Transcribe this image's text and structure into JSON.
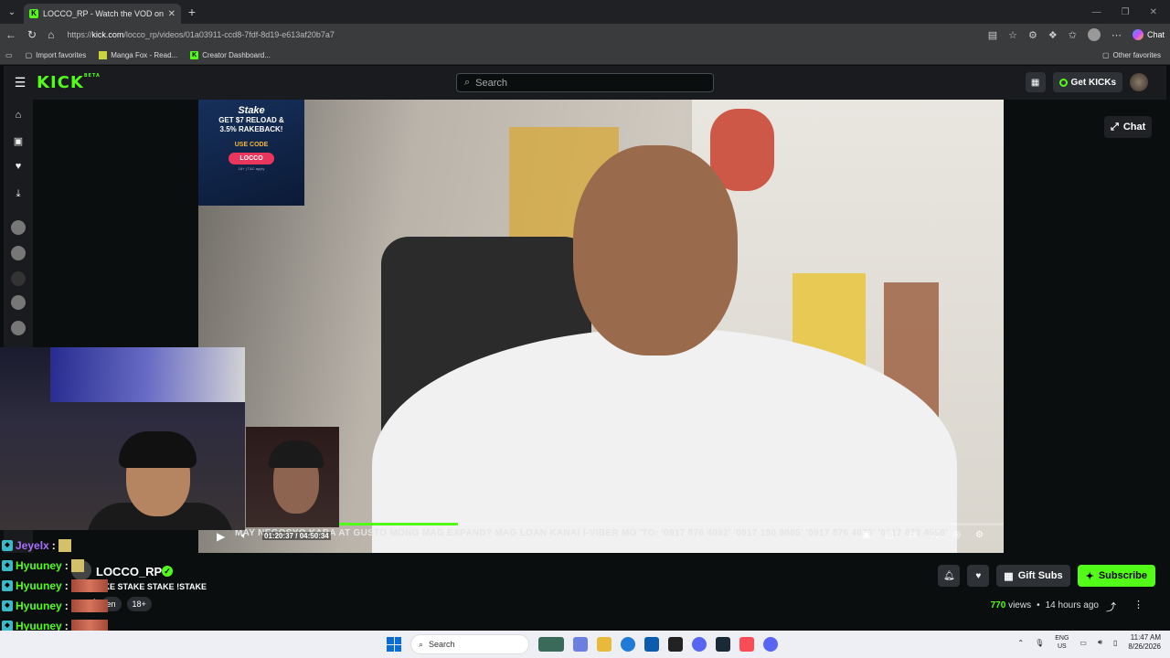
{
  "browser": {
    "tab_title": "LOCCO_RP - Watch the VOD on Kick",
    "url_prefix": "https://",
    "url_host": "kick.com",
    "url_path": "/locco_rp/videos/01a03911-ccd8-7fdf-8d19-e613af20b7a7",
    "chat_label": "Chat",
    "favorites": [
      {
        "label": "Import favorites"
      },
      {
        "label": "Manga Fox - Read..."
      },
      {
        "label": "Creator Dashboard..."
      }
    ],
    "other_favorites": "Other favorites"
  },
  "kick_header": {
    "logo": "KICK",
    "logo_badge": "BETA",
    "search_placeholder": "Search",
    "get_kicks": "Get KICKs"
  },
  "player": {
    "chat_button": "Chat",
    "ad": {
      "brand": "Stake",
      "line1": "GET $7 RELOAD &",
      "line2": "3.5% RAKEBACK!",
      "use_code": "USE CODE",
      "code": "LOCCO",
      "fine_print": "18+ | T&C apply"
    },
    "ticker": "MAY NEGOSYO KABA AT GUSTO MONG MAG EXPAND? MAG LOAN KANA! I-VIBER MO 'TO: '0917 876 4092' '0917 180 9885' '0917 876 4076' '0917 873 4958'",
    "elapsed": "01:20:37",
    "separator": "/",
    "duration": "04:50:34",
    "progress": 0.28
  },
  "stream_chat": [
    {
      "user": "Jeyelx",
      "sep": ":",
      "color": "purple"
    },
    {
      "user": "Hyuuney",
      "sep": ":",
      "color": "green"
    },
    {
      "user": "Hyuuney",
      "sep": ":",
      "color": "green"
    },
    {
      "user": "Hyuuney",
      "sep": ":",
      "color": "green"
    },
    {
      "user": "Hyuuney",
      "sep": ":",
      "color": "green"
    },
    {
      "user": "Hyuuney",
      "sep": ":",
      "color": "green"
    }
  ],
  "channel": {
    "name": "LOCCO_RP",
    "title": "AKE STAKE STAKE !STAKE",
    "tags": [
      "t",
      "en",
      "18+"
    ],
    "gift_subs": "Gift Subs",
    "subscribe": "Subscribe",
    "views": "770",
    "views_label": "views",
    "bullet": "•",
    "posted": "14 hours ago"
  },
  "taskbar": {
    "search": "Search",
    "lang_top": "ENG",
    "lang_bottom": "US",
    "time": "11:47 AM",
    "date": "8/26/2026"
  }
}
